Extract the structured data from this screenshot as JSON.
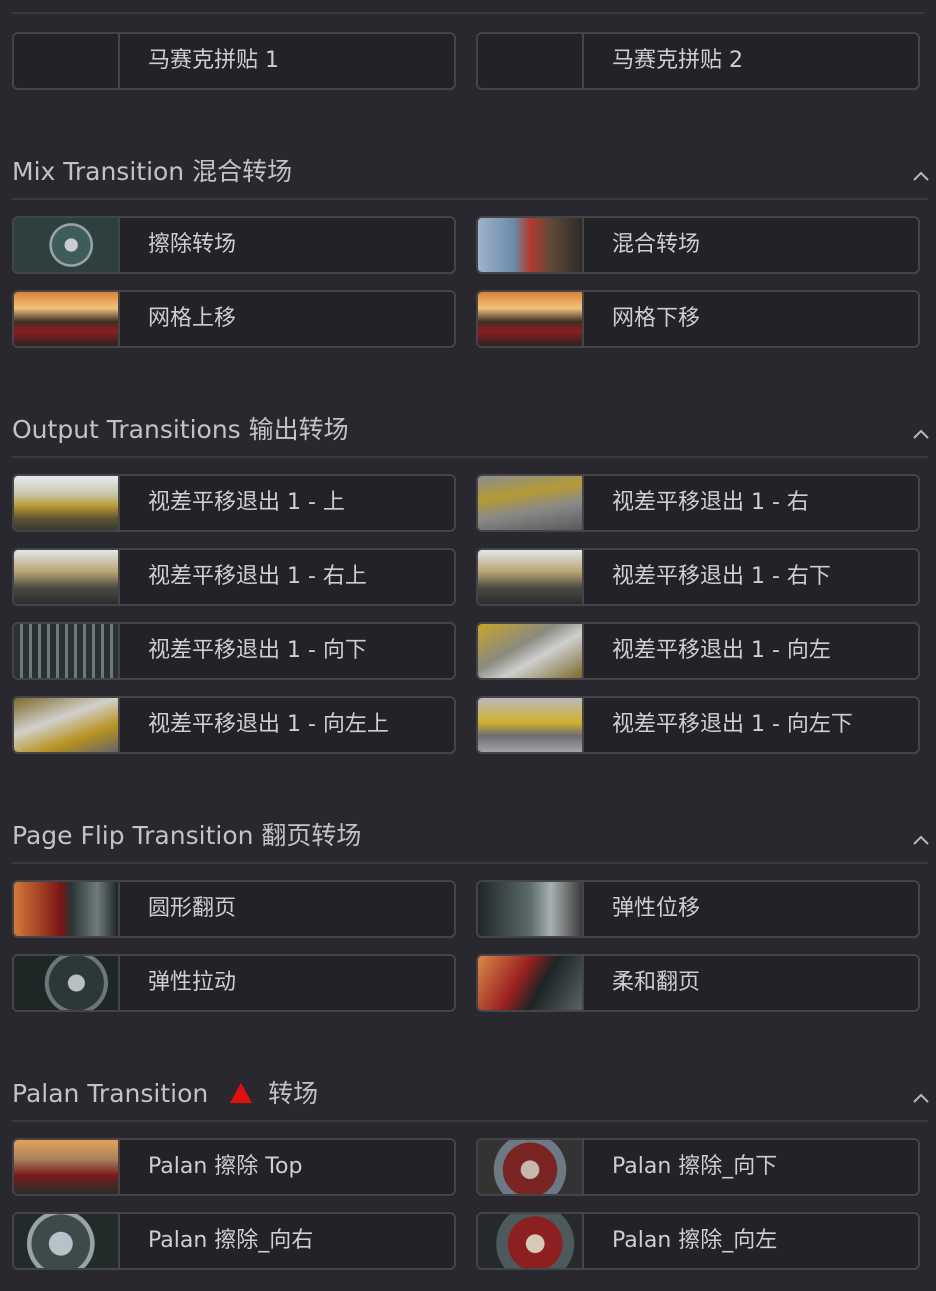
{
  "sections": [
    {
      "id": "mosaic",
      "title": "",
      "has_warning_icon": false,
      "items": [
        {
          "label": "马赛克拼贴 1",
          "thumb": "empty"
        },
        {
          "label": "马赛克拼贴 2",
          "thumb": "empty"
        }
      ]
    },
    {
      "id": "mix",
      "title": "Mix Transition 混合转场",
      "has_warning_icon": false,
      "items": [
        {
          "label": "擦除转场",
          "thumb": "wheel"
        },
        {
          "label": "混合转场",
          "thumb": "corridor"
        },
        {
          "label": "网格上移",
          "thumb": "sunset"
        },
        {
          "label": "网格下移",
          "thumb": "sunset"
        }
      ]
    },
    {
      "id": "output",
      "title": "Output Transitions 输出转场",
      "has_warning_icon": false,
      "items": [
        {
          "label": "视差平移退出 1 - 上",
          "thumb": "city"
        },
        {
          "label": "视差平移退出 1 - 右",
          "thumb": "blur1"
        },
        {
          "label": "视差平移退出 1 - 右上",
          "thumb": "city2"
        },
        {
          "label": "视差平移退出 1 - 右下",
          "thumb": "city2"
        },
        {
          "label": "视差平移退出 1 - 向下",
          "thumb": "aerial"
        },
        {
          "label": "视差平移退出 1 - 向左",
          "thumb": "blur2"
        },
        {
          "label": "视差平移退出 1 - 向左上",
          "thumb": "blur3"
        },
        {
          "label": "视差平移退出 1 - 向左下",
          "thumb": "blur4"
        }
      ]
    },
    {
      "id": "pageflip",
      "title": "Page Flip Transition 翻页转场",
      "has_warning_icon": false,
      "items": [
        {
          "label": "圆形翻页",
          "thumb": "carwheel"
        },
        {
          "label": "弹性位移",
          "thumb": "wheelcar"
        },
        {
          "label": "弹性拉动",
          "thumb": "wheel2"
        },
        {
          "label": "柔和翻页",
          "thumb": "carflip"
        }
      ]
    },
    {
      "id": "palan",
      "title_prefix": "Palan Transition",
      "title_suffix": "转场",
      "has_warning_icon": true,
      "items": [
        {
          "label": "Palan 擦除 Top",
          "thumb": "palan1"
        },
        {
          "label": "Palan 擦除_向下",
          "thumb": "palan2"
        },
        {
          "label": "Palan 擦除_向右",
          "thumb": "palan3"
        },
        {
          "label": "Palan 擦除_向左",
          "thumb": "palan4"
        }
      ]
    }
  ],
  "icons": {
    "collapse": "chevron-up-icon",
    "warning": "red-triangle-icon"
  },
  "colors": {
    "background": "#28282e",
    "item_border": "#444449",
    "warning": "#e01010"
  }
}
